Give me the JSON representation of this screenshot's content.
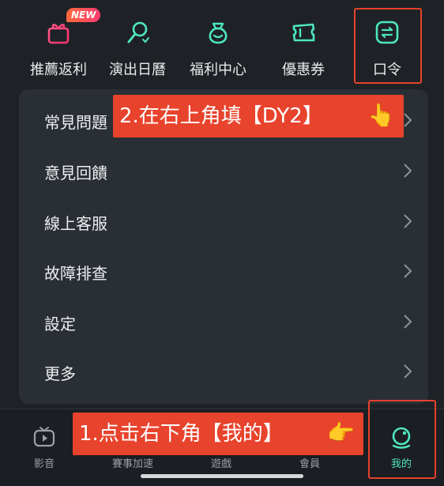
{
  "top_nav": {
    "items": [
      {
        "label": "推薦返利",
        "icon": "gift-icon",
        "badge": "NEW"
      },
      {
        "label": "演出日曆",
        "icon": "microphone-icon"
      },
      {
        "label": "福利中心",
        "icon": "money-bag-icon"
      },
      {
        "label": "優惠券",
        "icon": "coupon-icon"
      },
      {
        "label": "口令",
        "icon": "exchange-icon"
      }
    ]
  },
  "menu": {
    "items": [
      {
        "label": "常見問題"
      },
      {
        "label": "意見回饋"
      },
      {
        "label": "線上客服"
      },
      {
        "label": "故障排查"
      },
      {
        "label": "設定"
      },
      {
        "label": "更多"
      }
    ]
  },
  "callouts": {
    "step2": "2.在右上角填【DY2】",
    "step1": "1.点击右下角【我的】"
  },
  "bottom_tabs": {
    "items": [
      {
        "label": "影音",
        "icon": "tv-icon"
      },
      {
        "label": "賽事加速",
        "icon": "rocket-icon"
      },
      {
        "label": "遊戲",
        "icon": "gamepad-icon"
      },
      {
        "label": "會員",
        "icon": "crown-icon"
      },
      {
        "label": "我的",
        "icon": "profile-icon",
        "active": true
      }
    ]
  },
  "colors": {
    "accent": "#4ee6c0",
    "highlight": "#e8412c",
    "background": "#1e2226",
    "card": "#2a2f35"
  }
}
